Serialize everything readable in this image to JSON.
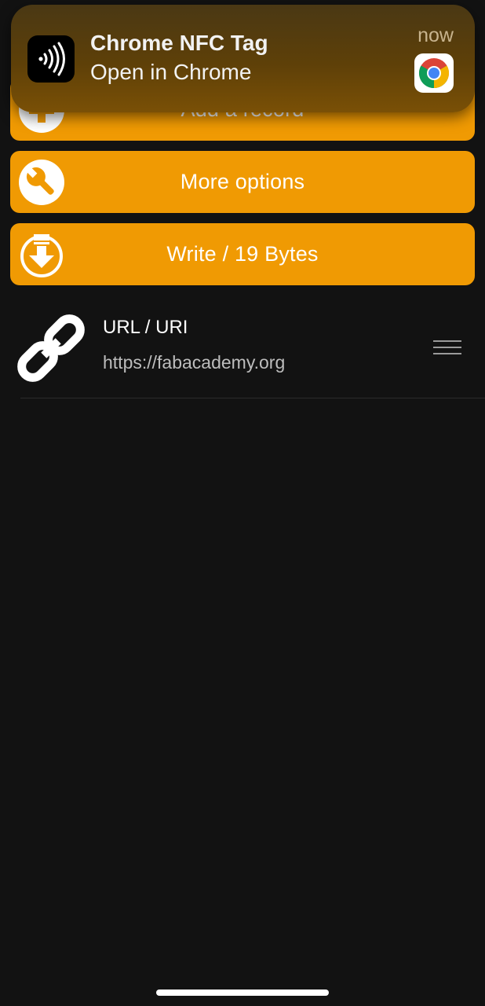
{
  "actions": {
    "add_record_label": "Add a record",
    "more_options_label": "More options",
    "write_label": "Write / 19 Bytes"
  },
  "record": {
    "type": "URL / URI",
    "value": "https://fabacademy.org"
  },
  "notification": {
    "title": "Chrome NFC Tag",
    "body": "Open in Chrome",
    "time": "now"
  },
  "icons": {
    "add": "plus-circle-icon",
    "more": "wrench-circle-icon",
    "write": "download-circle-icon",
    "record": "link-icon",
    "handle": "hamburger-icon",
    "notif_app": "nfc-icon",
    "notif_badge": "chrome-icon"
  },
  "colors": {
    "accent": "#f09a03",
    "background": "#121212",
    "notification": "#5e4008"
  }
}
